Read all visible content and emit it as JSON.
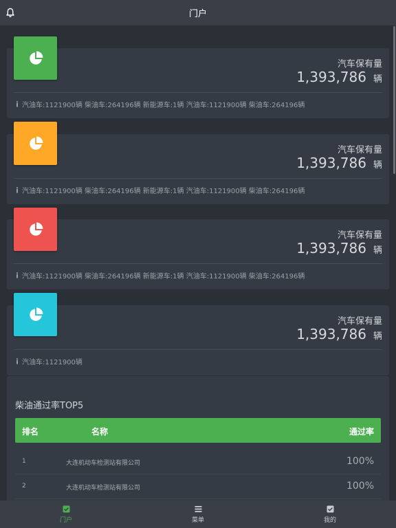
{
  "header": {
    "title": "门户",
    "bell_icon": "bell-icon"
  },
  "colors": {
    "green": "#4caf50",
    "orange": "#ffa726",
    "red": "#ef5350",
    "cyan": "#26c6da",
    "card_bg": "#353b44",
    "page_bg": "#2b3036"
  },
  "stat_cards": [
    {
      "icon": "pie-chart-icon",
      "title": "汽车保有量",
      "value": "1,393,786",
      "unit": "辆",
      "footer": "汽油车:1121900辆 柴油车:264196辆 新能源车:1辆 汽油车:1121900辆 柴油车:264196辆"
    },
    {
      "icon": "pie-chart-icon",
      "title": "汽车保有量",
      "value": "1,393,786",
      "unit": "辆",
      "footer": "汽油车:1121900辆 柴油车:264196辆 新能源车:1辆 汽油车:1121900辆 柴油车:264196辆"
    },
    {
      "icon": "pie-chart-icon",
      "title": "汽车保有量",
      "value": "1,393,786",
      "unit": "辆",
      "footer": "汽油车:1121900辆 柴油车:264196辆 新能源车:1辆 汽油车:1121900辆 柴油车:264196辆"
    },
    {
      "icon": "pie-chart-icon",
      "title": "汽车保有量",
      "value": "1,393,786",
      "unit": "辆",
      "footer": "汽油车:1121900辆"
    }
  ],
  "ranking": {
    "title": "柴油通过率TOP5",
    "columns": {
      "rank": "排名",
      "name": "名称",
      "rate": "通过率"
    },
    "rows": [
      {
        "rank": "1",
        "name": "大连机动车检测站有限公司",
        "rate": "100%"
      },
      {
        "rank": "2",
        "name": "大连机动车检测站有限公司",
        "rate": "100%"
      }
    ]
  },
  "bottom_nav": [
    {
      "label": "门户",
      "icon": "portal-icon",
      "active": true
    },
    {
      "label": "菜单",
      "icon": "menu-icon",
      "active": false
    },
    {
      "label": "我的",
      "icon": "profile-icon",
      "active": false
    }
  ]
}
